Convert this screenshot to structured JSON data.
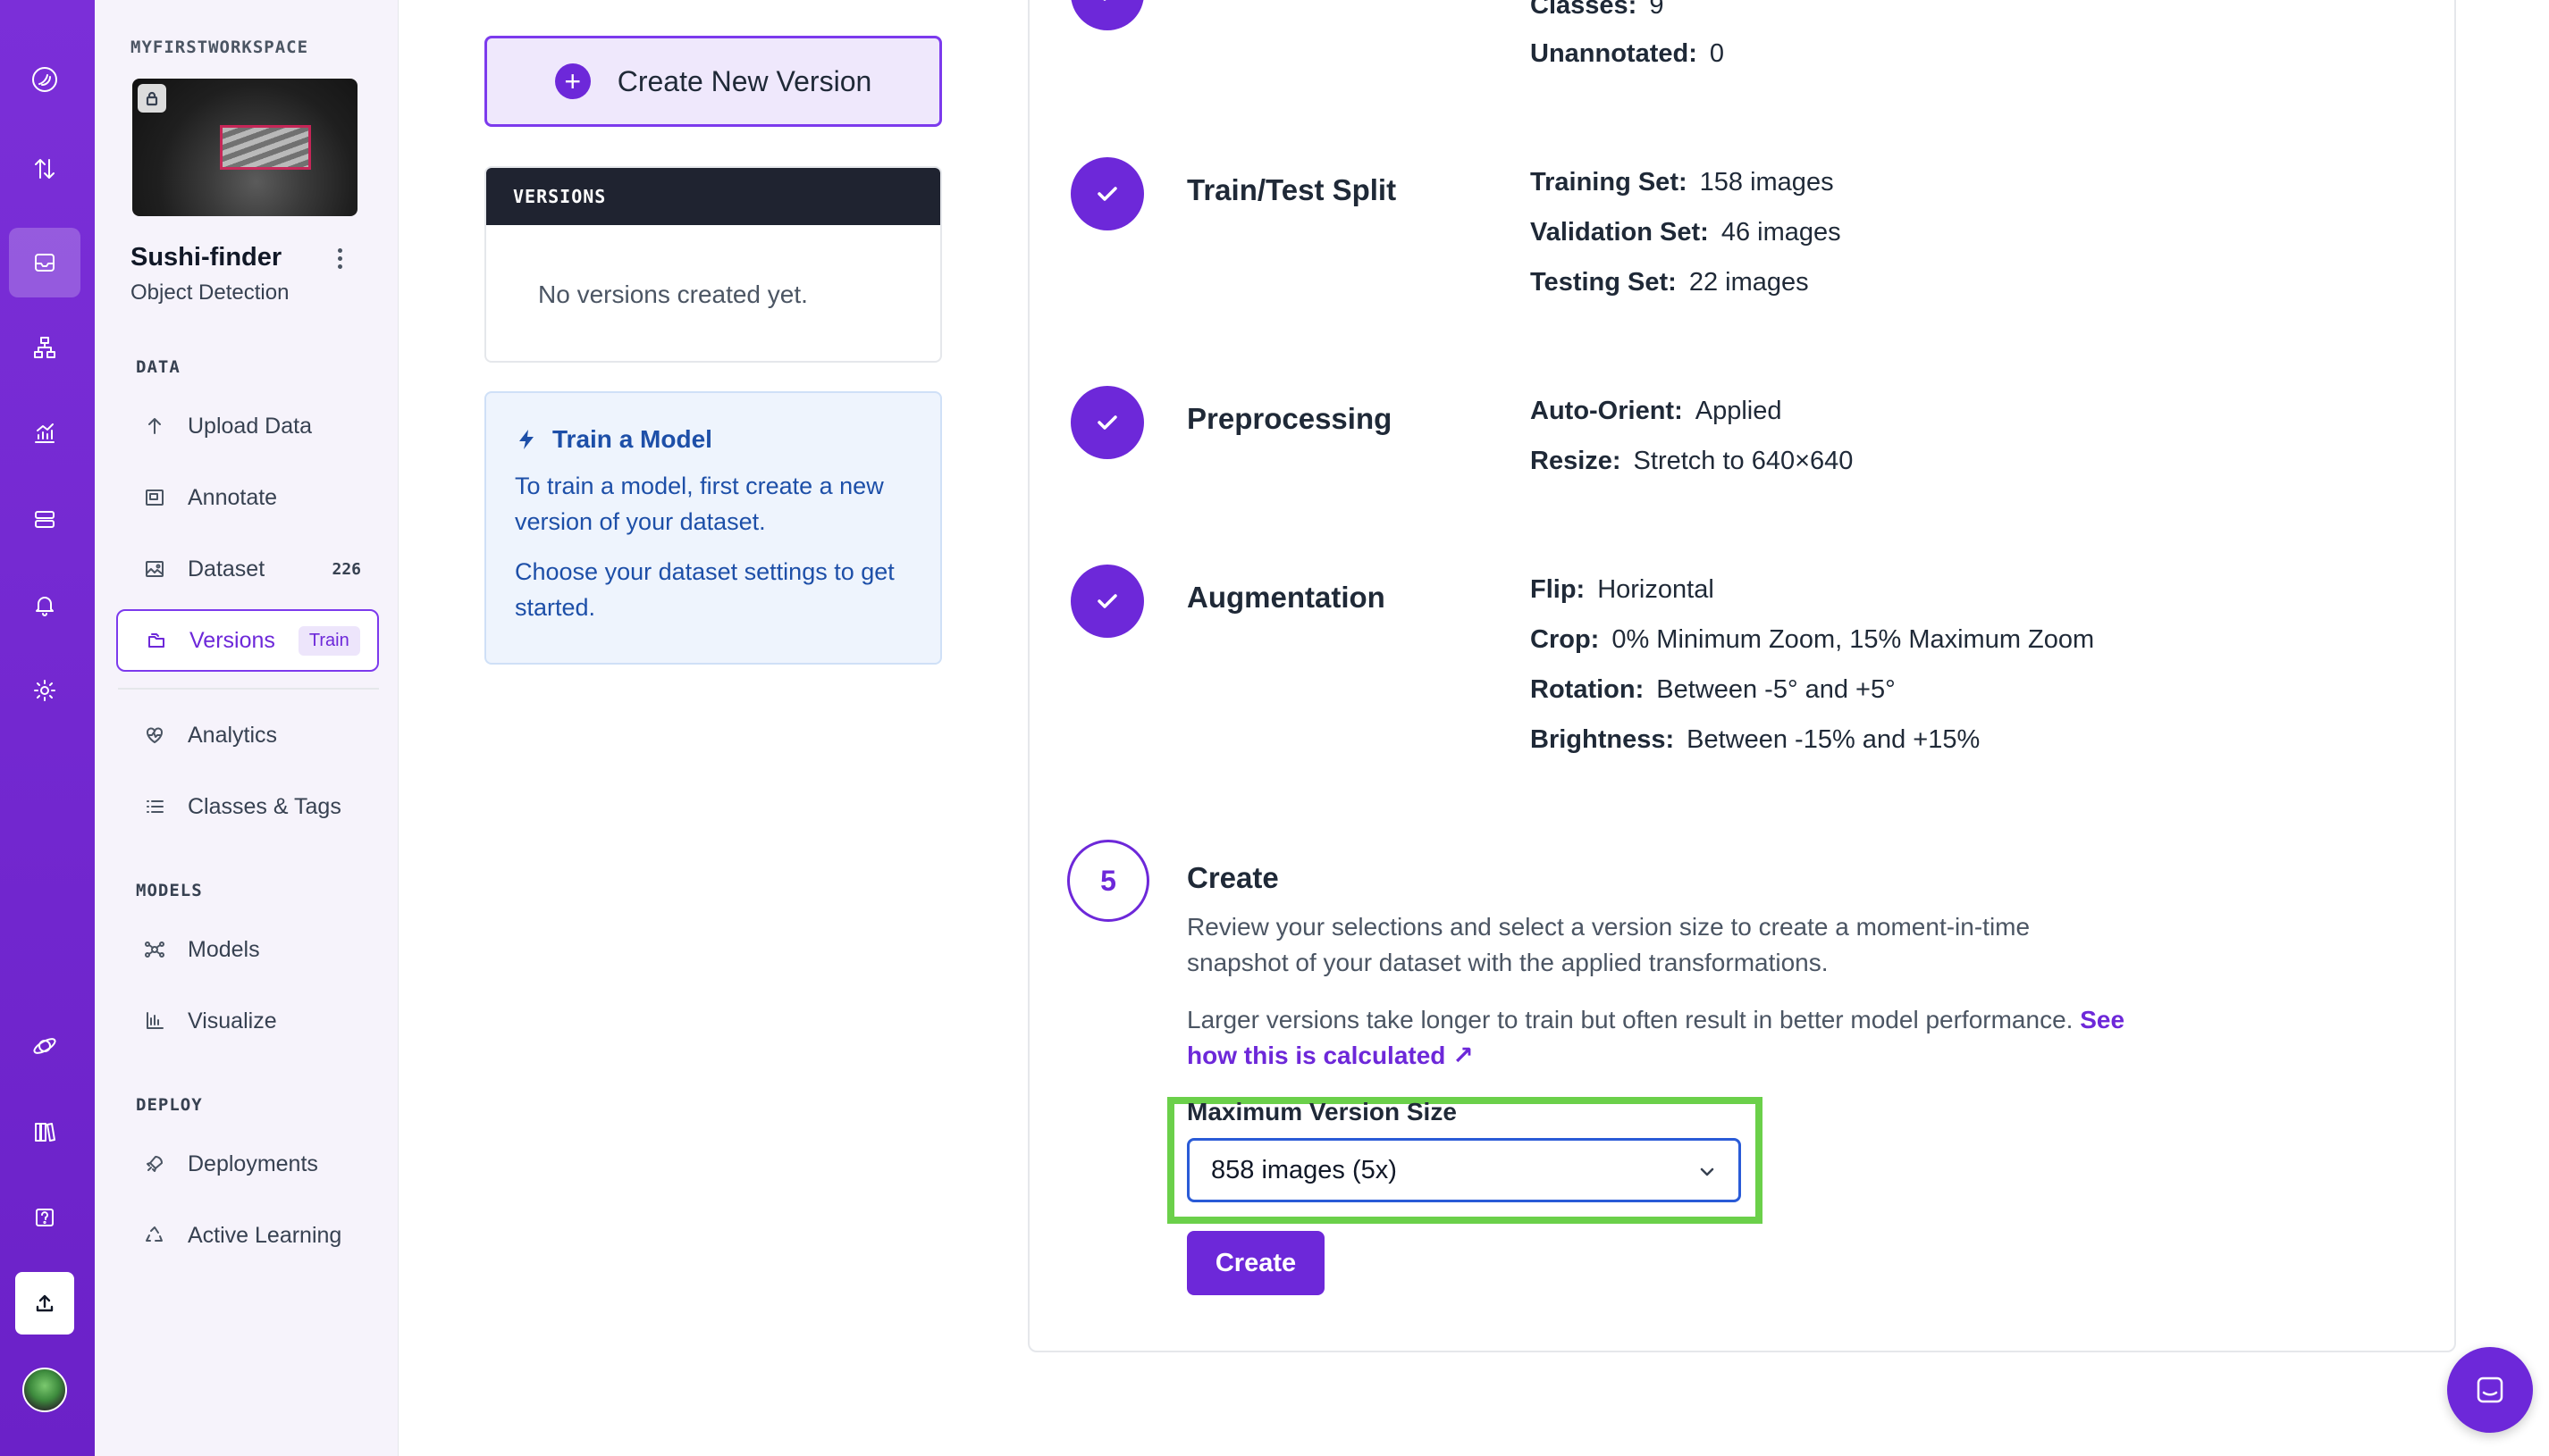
{
  "workspace": {
    "name": "MYFIRSTWORKSPACE"
  },
  "project": {
    "name": "Sushi-finder",
    "type": "Object Detection"
  },
  "sidebar": {
    "sections": {
      "data": "DATA",
      "models": "MODELS",
      "deploy": "DEPLOY"
    },
    "data_items": [
      {
        "label": "Upload Data",
        "icon": "arrow-up-icon"
      },
      {
        "label": "Annotate",
        "icon": "annotate-icon"
      },
      {
        "label": "Dataset",
        "icon": "images-icon",
        "count": "226"
      },
      {
        "label": "Versions",
        "icon": "folders-icon",
        "badge": "Train",
        "active": true
      },
      {
        "label": "Analytics",
        "icon": "heart-pulse-icon"
      },
      {
        "label": "Classes & Tags",
        "icon": "list-icon"
      }
    ],
    "model_items": [
      {
        "label": "Models",
        "icon": "network-icon"
      },
      {
        "label": "Visualize",
        "icon": "chart-icon"
      }
    ],
    "deploy_items": [
      {
        "label": "Deployments",
        "icon": "rocket-icon"
      },
      {
        "label": "Active Learning",
        "icon": "recycle-icon"
      }
    ]
  },
  "left": {
    "create_button": "Create New Version",
    "versions_header": "VERSIONS",
    "versions_empty": "No versions created yet.",
    "train_title": "Train a Model",
    "train_p1": "To train a model, first create a new version of your dataset.",
    "train_p2": "Choose your dataset settings to get started."
  },
  "steps": {
    "top_partial": [
      {
        "key": "Classes:",
        "value": "9"
      },
      {
        "key": "Unannotated:",
        "value": "0"
      }
    ],
    "split": {
      "title": "Train/Test Split",
      "rows": [
        {
          "key": "Training Set:",
          "value": "158 images"
        },
        {
          "key": "Validation Set:",
          "value": "46 images"
        },
        {
          "key": "Testing Set:",
          "value": "22 images"
        }
      ]
    },
    "preprocessing": {
      "title": "Preprocessing",
      "rows": [
        {
          "key": "Auto-Orient:",
          "value": "Applied"
        },
        {
          "key": "Resize:",
          "value": "Stretch to 640×640"
        }
      ]
    },
    "augmentation": {
      "title": "Augmentation",
      "rows": [
        {
          "key": "Flip:",
          "value": "Horizontal"
        },
        {
          "key": "Crop:",
          "value": "0% Minimum Zoom, 15% Maximum Zoom"
        },
        {
          "key": "Rotation:",
          "value": "Between -5° and +5°"
        },
        {
          "key": "Brightness:",
          "value": "Between -15% and +15%"
        }
      ]
    },
    "create": {
      "number": "5",
      "title": "Create",
      "desc1": "Review your selections and select a version size to create a moment-in-time snapshot of your dataset with the applied transformations.",
      "desc2": "Larger versions take longer to train but often result in better model performance.",
      "link": "See how this is calculated",
      "field_label": "Maximum Version Size",
      "select_value": "858 images (5x)",
      "button": "Create"
    }
  },
  "colors": {
    "brand": "#6d28d9",
    "highlight": "#6bd04a",
    "select_border": "#2a5bd7"
  }
}
